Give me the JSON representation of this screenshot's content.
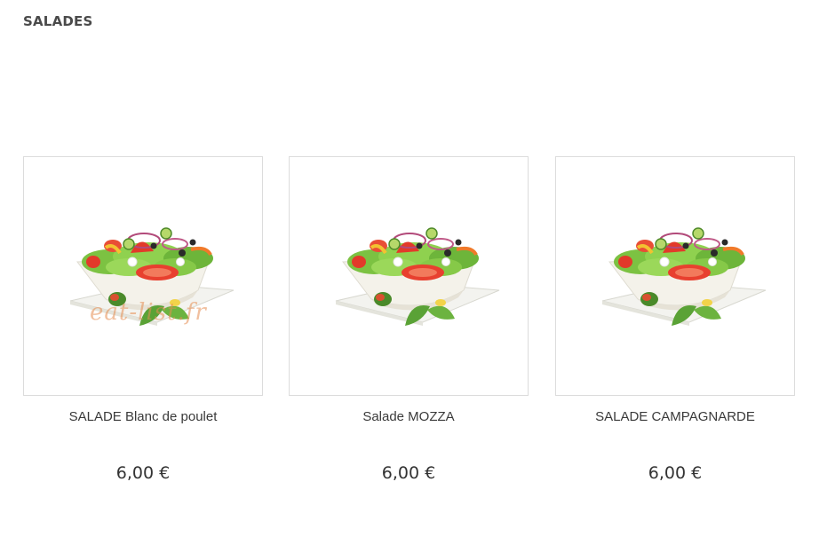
{
  "section": {
    "title": "SALADES"
  },
  "products": [
    {
      "name": "SALADE Blanc de poulet",
      "price": "6,00 €",
      "image": "salad-bowl-image",
      "watermark": "eat-list.fr"
    },
    {
      "name": "Salade MOZZA",
      "price": "6,00 €",
      "image": "salad-bowl-image"
    },
    {
      "name": "SALADE CAMPAGNARDE",
      "price": "6,00 €",
      "image": "salad-bowl-image"
    }
  ]
}
